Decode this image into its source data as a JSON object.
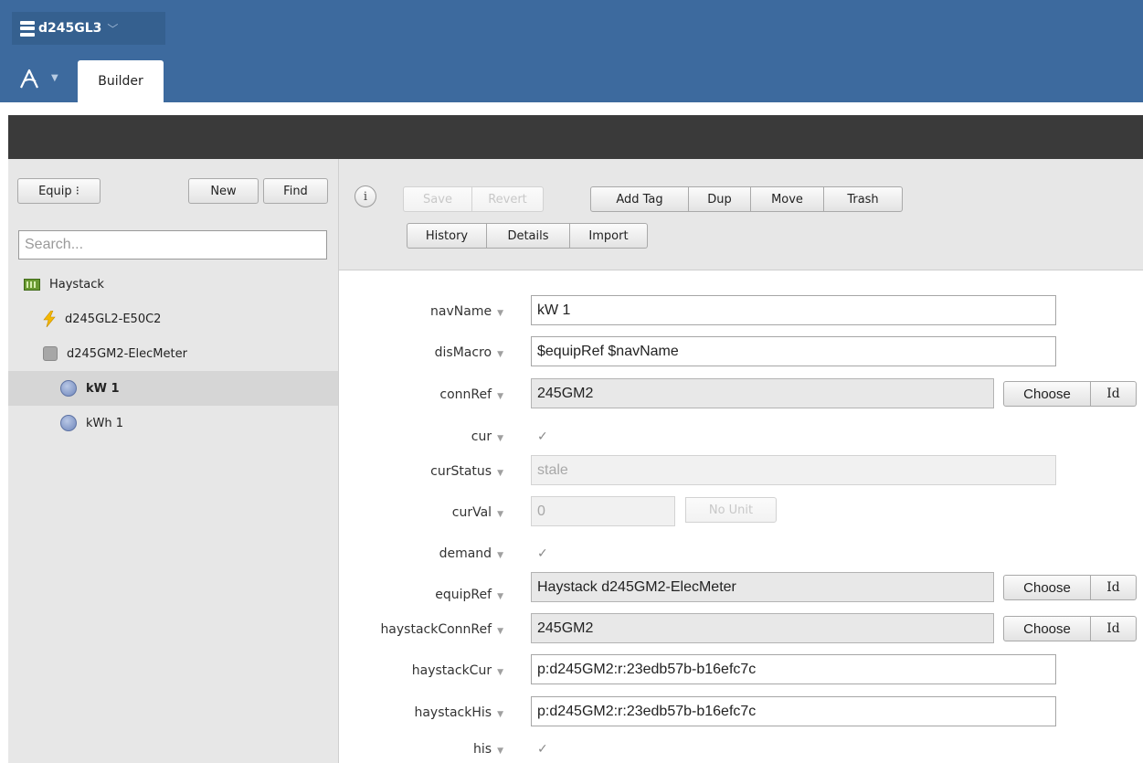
{
  "header": {
    "project_name": "d245GL3",
    "tabs": [
      {
        "label": "Builder"
      }
    ]
  },
  "left_panel": {
    "type_select": "Equip ⁝",
    "new_label": "New",
    "find_label": "Find",
    "search_placeholder": "Search...",
    "tree": [
      {
        "label": "Haystack",
        "icon": "site-icon"
      },
      {
        "label": "d245GL2-E50C2",
        "icon": "connector-icon"
      },
      {
        "label": "d245GM2-ElecMeter",
        "icon": "equip-icon"
      },
      {
        "label": "kW 1",
        "icon": "point-icon",
        "selected": true
      },
      {
        "label": "kWh 1",
        "icon": "point-icon"
      }
    ]
  },
  "toolbar": {
    "info_label": "i",
    "save_label": "Save",
    "revert_label": "Revert",
    "add_tag_label": "Add Tag",
    "dup_label": "Dup",
    "move_label": "Move",
    "trash_label": "Trash",
    "history_label": "History",
    "details_label": "Details",
    "import_label": "Import"
  },
  "form": {
    "arrow": "▼",
    "check": "✓",
    "choose_label": "Choose",
    "id_label": "Id",
    "no_unit_label": "No Unit",
    "fields": {
      "navName": {
        "label": "navName",
        "value": "kW 1"
      },
      "disMacro": {
        "label": "disMacro",
        "value": "$equipRef $navName"
      },
      "connRef": {
        "label": "connRef",
        "value": "245GM2"
      },
      "cur": {
        "label": "cur"
      },
      "curStatus": {
        "label": "curStatus",
        "value": "stale"
      },
      "curVal": {
        "label": "curVal",
        "value": "0"
      },
      "demand": {
        "label": "demand"
      },
      "equipRef": {
        "label": "equipRef",
        "value": "Haystack d245GM2-ElecMeter"
      },
      "haystackConnRef": {
        "label": "haystackConnRef",
        "value": "245GM2"
      },
      "haystackCur": {
        "label": "haystackCur",
        "value": "p:d245GM2:r:23edb57b-b16efc7c"
      },
      "haystackHis": {
        "label": "haystackHis",
        "value": "p:d245GM2:r:23edb57b-b16efc7c"
      },
      "his": {
        "label": "his"
      }
    }
  },
  "colors": {
    "header_bg": "#3d6a9e",
    "dark_bar": "#3a3a3a",
    "panel_bg": "#e7e7e7",
    "connector_icon": "#f5b800"
  }
}
